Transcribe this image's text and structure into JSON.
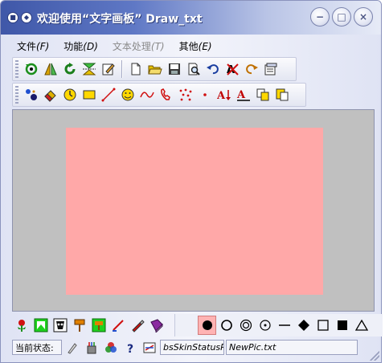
{
  "window": {
    "title": "欢迎使用“文字画板” Draw_txt",
    "controls": {
      "minimize": "−",
      "maximize": "□",
      "close": "×"
    }
  },
  "menu": [
    {
      "label": "文件",
      "accel": "(F)",
      "enabled": true
    },
    {
      "label": "功能",
      "accel": "(D)",
      "enabled": true
    },
    {
      "label": "文本处理",
      "accel": "(T)",
      "enabled": false
    },
    {
      "label": "其他",
      "accel": "(E)",
      "enabled": true
    }
  ],
  "toolbar1": {
    "group1": [
      "refresh-green-icon",
      "flip-horizontal-icon",
      "rotate-icon",
      "flip-vertical-icon",
      "edit-icon"
    ],
    "group2": [
      "new-file-icon",
      "open-folder-icon",
      "save-icon",
      "print-preview-icon",
      "undo-icon",
      "clear-text-icon",
      "redo-icon",
      "properties-icon"
    ]
  },
  "toolbar2": {
    "tools": [
      "point-color-icon",
      "eraser-icon",
      "clock-icon",
      "rectangle-icon",
      "line-icon",
      "smiley-icon",
      "curve-icon",
      "telephone-icon",
      "dots-icon",
      "point-icon",
      "text-size-icon",
      "text-format-icon",
      "copy-icon",
      "paste-icon"
    ]
  },
  "canvas": {
    "background_color": "#c0c0c0",
    "drawing_color": "#ffa8a8"
  },
  "palette": {
    "tools": [
      "flower-icon",
      "green-frame-icon",
      "mask-icon",
      "brush-stand-icon",
      "paint-bucket-icon",
      "paint-brush-icon",
      "pen-icon",
      "book-icon"
    ],
    "shapes": [
      "filled-circle-icon",
      "circle-icon",
      "double-circle-icon",
      "dot-circle-icon",
      "horizontal-line-icon",
      "filled-diamond-icon",
      "square-icon",
      "filled-square-icon",
      "triangle-icon"
    ],
    "active_shape": "filled-circle-icon"
  },
  "status": {
    "label": "当前状态:",
    "skin_panel": "bsSkinStatusP",
    "file_name": "NewPic.txt"
  }
}
